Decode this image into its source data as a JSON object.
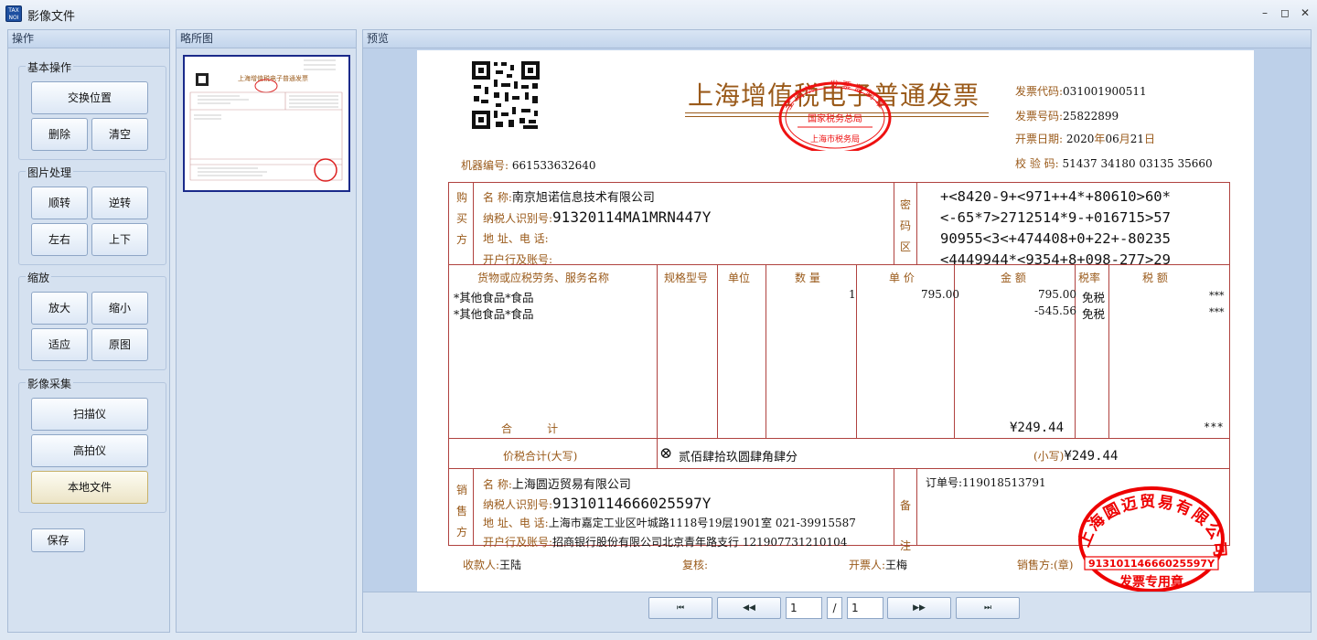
{
  "window": {
    "title": "影像文件",
    "icon_text_top": "TAX",
    "icon_text_bottom": "NOI",
    "minimize_glyph": "–",
    "restore_glyph": "◻",
    "close_glyph": "✕"
  },
  "panels": {
    "ops": "操作",
    "thumbs": "略所图",
    "preview": "预览"
  },
  "groups": {
    "basic": {
      "label": "基本操作",
      "swap": "交换位置",
      "delete": "删除",
      "clear": "清空"
    },
    "image": {
      "label": "图片处理",
      "cw": "顺转",
      "ccw": "逆转",
      "flip_h": "左右",
      "flip_v": "上下"
    },
    "zoom": {
      "label": "缩放",
      "zoom_in": "放大",
      "zoom_out": "缩小",
      "fit": "适应",
      "original": "原图"
    },
    "capture": {
      "label": "影像采集",
      "scanner": "扫描仪",
      "camera": "高拍仪",
      "local": "本地文件"
    },
    "save": "保存"
  },
  "thumbnail": {
    "title": "上海增值税电子普通发票"
  },
  "invoice": {
    "title": "上海增值税电子普通发票",
    "stamp_top": {
      "ring": "全 国 统 一 发 票 监 制 章",
      "middle": "国家税务总局",
      "bottom": "上海市税务局"
    },
    "code_label": "发票代码:",
    "code": "031001900511",
    "number_label": "发票号码:",
    "number": "25822899",
    "date_label": "开票日期:",
    "date_y": "2020",
    "date_yl": "年",
    "date_m": "06",
    "date_ml": "月",
    "date_d": "21",
    "date_dl": "日",
    "check_label": "校 验 码:",
    "check": "51437 34180 03135 35660",
    "machine_label": "机器编号:",
    "machine": "661533632640",
    "buyer_side": [
      "购",
      "买",
      "方"
    ],
    "buyer": {
      "name_label": "名         称:",
      "name": "南京旭诺信息技术有限公司",
      "tax_label": "纳税人识别号:",
      "tax_id": "91320114MA1MRN447Y",
      "addr_label": "地  址、电  话:",
      "bank_label": "开户行及账号:"
    },
    "cipher_side": [
      "密",
      "码",
      "区"
    ],
    "cipher": [
      "+<8420-9+<971++4*+80610>60*",
      "<-65*7>2712514*9-+016715>57",
      "90955<3<+474408+0+22+-80235",
      "<4449944*<9354+8+098-277>29"
    ],
    "headers": {
      "item": "货物或应税劳务、服务名称",
      "spec": "规格型号",
      "unit": "单位",
      "qty": "数  量",
      "price": "单  价",
      "amount": "金  额",
      "rate": "税率",
      "tax": "税  额"
    },
    "rows": [
      {
        "name": "*其他食品*食品",
        "qty": "1",
        "price": "795.00",
        "amount": "795.00",
        "rate": "免税",
        "tax": "***"
      },
      {
        "name": "*其他食品*食品",
        "qty": "",
        "price": "",
        "amount": "-545.56",
        "rate": "免税",
        "tax": "***"
      }
    ],
    "total_label": "合          计",
    "total_amount": "¥249.44",
    "total_tax": "***",
    "sum_label": "价税合计(大写)",
    "sum_symbol": "⊗",
    "sum_upper": "贰佰肆拾玖圆肆角肆分",
    "sum_lower_label": "(小写)",
    "sum_lower": "¥249.44",
    "seller_side": [
      "销",
      "售",
      "方"
    ],
    "seller": {
      "name_label": "名         称:",
      "name": "上海圆迈贸易有限公司",
      "tax_label": "纳税人识别号:",
      "tax_id": "91310114666025597Y",
      "addr_label": "地  址、电  话:",
      "addr": "上海市嘉定工业区叶城路1118号19层1901室 021-39915587",
      "bank_label": "开户行及账号:",
      "bank": "招商银行股份有限公司北京青年路支行 121907731210104"
    },
    "remark_side": [
      "备",
      "注"
    ],
    "remark": "订单号:119018513791",
    "stamp_seller": {
      "ring": "上海圆迈贸易有限公司",
      "id": "91310114666025597Y",
      "bottom": "发票专用章"
    },
    "payee_label": "收款人:",
    "payee": "王陆",
    "reviewer_label": "复核:",
    "issuer_label": "开票人:",
    "issuer": "王梅",
    "seller_sign": "销售方:(章)"
  },
  "pager": {
    "first": "⏮",
    "prev": "◀◀",
    "current": "1",
    "sep": "/",
    "total": "1",
    "next": "▶▶",
    "last": "⏭"
  }
}
